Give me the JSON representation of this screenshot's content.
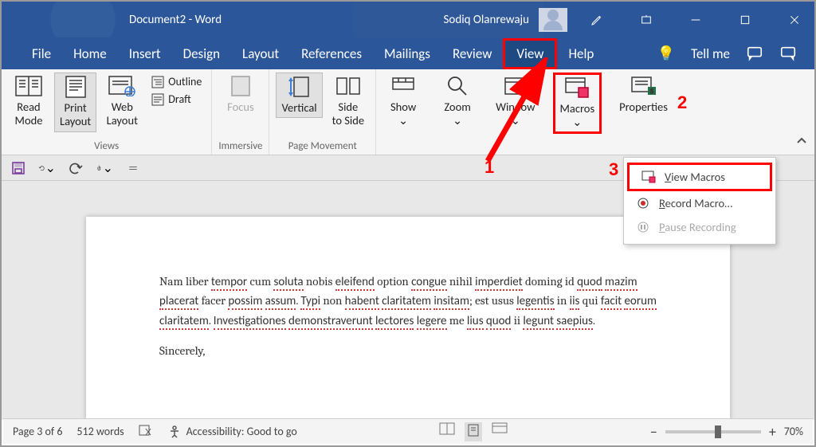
{
  "title_bar": {
    "document_title": "Document2  -  Word",
    "user_name": "Sodiq Olanrewaju"
  },
  "menu": {
    "items": [
      "File",
      "Home",
      "Insert",
      "Design",
      "Layout",
      "References",
      "Mailings",
      "Review",
      "View",
      "Help"
    ],
    "active_index": 8,
    "tell_me": "Tell me"
  },
  "ribbon": {
    "groups": {
      "views": {
        "label": "Views",
        "read_mode": "Read\nMode",
        "print_layout": "Print\nLayout",
        "web_layout": "Web\nLayout",
        "outline": "Outline",
        "draft": "Draft"
      },
      "immersive": {
        "label": "Immersive",
        "focus": "Focus"
      },
      "page_movement": {
        "label": "Page Movement",
        "vertical": "Vertical",
        "side_to_side": "Side\nto Side"
      },
      "show": "Show",
      "zoom": "Zoom",
      "window": "Window",
      "macros": "Macros",
      "properties": "Properties"
    }
  },
  "macros_menu": {
    "view_macros": "View Macros",
    "record_macro": "Record Macro…",
    "pause_recording": "Pause Recording"
  },
  "document": {
    "paragraph": "Nam liber tempor cum soluta nobis eleifend option congue nihil imperdiet doming id quod mazim placerat facer possim assum. Typi non habent claritatem insitam; est usus legentis in iis qui facit eorum claritatem. Investigationes demonstraverunt lectores legere me lius quod ii legunt saepius.",
    "signoff": "Sincerely,"
  },
  "status_bar": {
    "page": "Page 3 of 6",
    "words": "512 words",
    "accessibility": "Accessibility: Good to go",
    "zoom": "70%"
  },
  "annotations": {
    "1": "1",
    "2": "2",
    "3": "3"
  }
}
